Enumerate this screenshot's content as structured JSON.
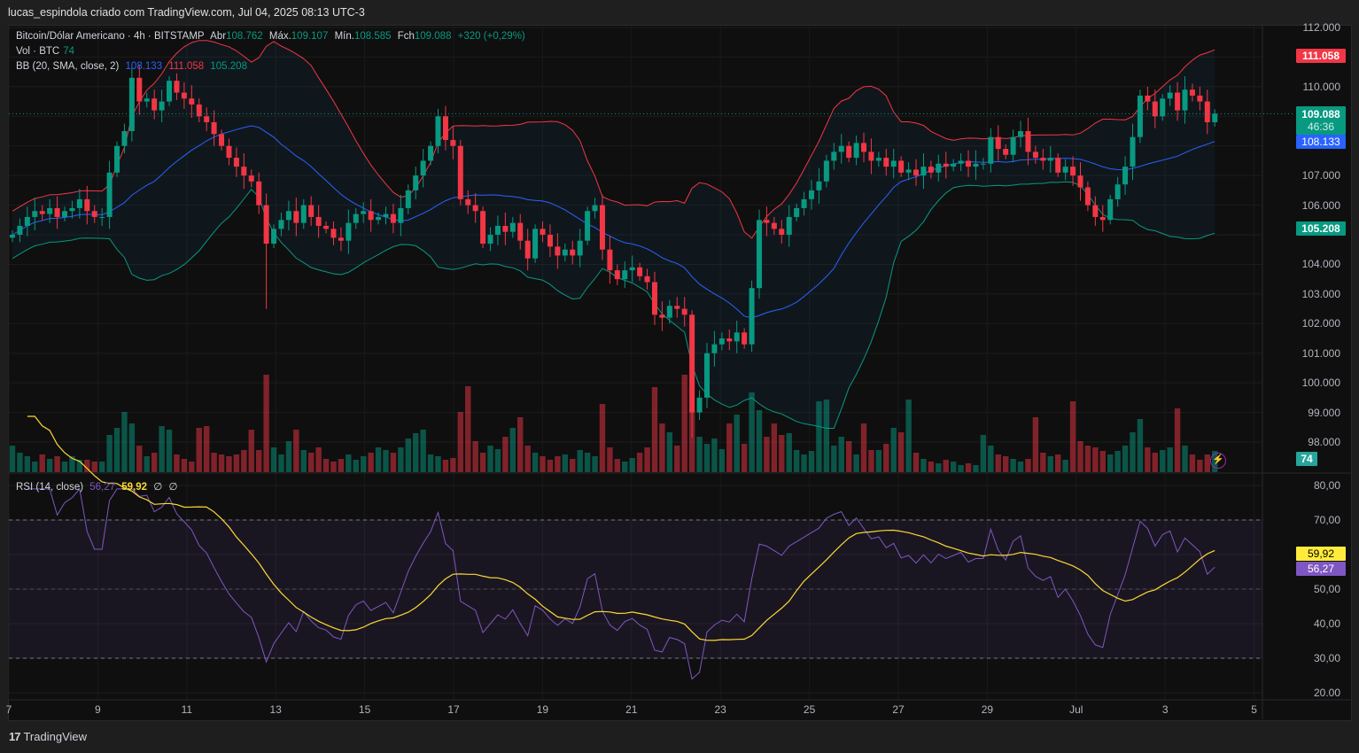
{
  "topbar": {
    "title": "lucas_espindola criado com TradingView.com, Jul 04, 2025 08:13 UTC-3"
  },
  "legend": {
    "symbol": "Bitcoin/Dólar Americano · 4h · BITSTAMP",
    "open_label": "Abr",
    "open": "108.762",
    "high_label": "Máx.",
    "high": "109.107",
    "low_label": "Mín.",
    "low": "108.585",
    "close_label": "Fch",
    "close": "109.088",
    "change": "+320 (+0,29%)",
    "vol_label": "Vol · BTC",
    "vol": "74",
    "bb_label": "BB (20, SMA, close, 2)",
    "bb_basis": "108.133",
    "bb_upper": "111.058",
    "bb_lower": "105.208",
    "rsi_label": "RSI (14, close)",
    "rsi": "56,27",
    "rsi_ma": "59,92",
    "rsi_x1": "∅",
    "rsi_x2": "∅"
  },
  "price_axis": [
    "112.000",
    "110.000",
    "107.000",
    "106.000",
    "104.000",
    "103.000",
    "102.000",
    "101.000",
    "100.000",
    "99.000",
    "98.000"
  ],
  "price_tags": {
    "upper": "111.058",
    "last": "109.088",
    "countdown": "46:36",
    "basis": "108.133",
    "lower": "105.208",
    "volume": "74"
  },
  "rsi_axis": [
    "80,00",
    "70,00",
    "50,00",
    "40,00",
    "30,00",
    "20.00"
  ],
  "rsi_tags": {
    "ma": "59,92",
    "rsi": "56,27"
  },
  "date_axis": [
    "7",
    "9",
    "11",
    "13",
    "15",
    "17",
    "19",
    "21",
    "23",
    "25",
    "27",
    "29",
    "Jul",
    "3",
    "5"
  ],
  "footer": {
    "brand": "TradingView"
  },
  "colors": {
    "up": "#089981",
    "down": "#f23645",
    "basis": "#2962ff",
    "rsi": "#7e57c2",
    "rsi_ma": "#fdd835"
  },
  "chart_data": {
    "type": "candlestick",
    "timeframe": "4h",
    "ylim": [
      97500,
      112000
    ],
    "closes": [
      105.0,
      105.3,
      105.6,
      105.8,
      105.7,
      105.9,
      105.6,
      105.8,
      105.9,
      106.2,
      105.8,
      105.6,
      105.6,
      107.1,
      108.0,
      108.5,
      110.3,
      109.5,
      109.6,
      109.2,
      109.5,
      110.2,
      109.8,
      109.6,
      109.4,
      109.0,
      108.8,
      108.4,
      108.0,
      107.6,
      107.3,
      107.0,
      106.8,
      106.0,
      104.7,
      105.2,
      105.5,
      105.8,
      105.4,
      106.0,
      105.6,
      105.3,
      105.2,
      104.9,
      104.8,
      105.4,
      105.7,
      105.8,
      105.5,
      105.6,
      105.7,
      105.4,
      105.9,
      106.5,
      107.0,
      107.5,
      108.0,
      109.0,
      108.2,
      108.0,
      106.2,
      106.0,
      105.8,
      104.7,
      105.0,
      105.3,
      105.1,
      105.4,
      104.8,
      104.2,
      105.2,
      105.0,
      104.6,
      104.3,
      104.5,
      104.3,
      104.8,
      105.8,
      106.0,
      104.5,
      103.8,
      103.5,
      103.8,
      103.9,
      103.6,
      103.4,
      102.3,
      102.2,
      102.6,
      102.5,
      102.3,
      99.0,
      99.5,
      101.0,
      101.3,
      101.5,
      101.4,
      101.7,
      101.3,
      103.2,
      105.5,
      105.4,
      105.2,
      105.0,
      105.6,
      105.9,
      106.2,
      106.5,
      106.8,
      107.5,
      107.8,
      108.0,
      107.6,
      108.1,
      107.8,
      107.5,
      107.6,
      107.3,
      107.5,
      107.1,
      107.2,
      107.0,
      107.3,
      107.1,
      107.4,
      107.3,
      107.4,
      107.5,
      107.3,
      107.4,
      107.4,
      108.3,
      107.9,
      107.7,
      108.3,
      108.5,
      107.8,
      107.6,
      107.5,
      107.6,
      107.1,
      107.3,
      107.0,
      106.6,
      106.0,
      105.6,
      105.5,
      106.2,
      106.7,
      107.3,
      108.3,
      109.7,
      109.5,
      109.0,
      109.6,
      109.8,
      109.2,
      109.9,
      109.7,
      109.5,
      108.8,
      109.088
    ],
    "volumes": [
      30,
      22,
      18,
      12,
      20,
      15,
      18,
      12,
      18,
      14,
      14,
      12,
      12,
      42,
      50,
      68,
      55,
      30,
      18,
      22,
      52,
      48,
      20,
      15,
      12,
      50,
      52,
      22,
      20,
      18,
      20,
      25,
      48,
      25,
      110,
      28,
      20,
      35,
      48,
      25,
      22,
      28,
      15,
      12,
      15,
      20,
      14,
      18,
      22,
      28,
      25,
      22,
      28,
      38,
      44,
      48,
      20,
      18,
      14,
      16,
      68,
      97,
      35,
      22,
      30,
      26,
      40,
      50,
      62,
      30,
      22,
      18,
      14,
      18,
      20,
      15,
      25,
      22,
      18,
      77,
      28,
      15,
      12,
      16,
      22,
      28,
      96,
      55,
      45,
      30,
      110,
      70,
      40,
      32,
      38,
      26,
      55,
      65,
      32,
      90,
      70,
      40,
      55,
      42,
      44,
      25,
      20,
      24,
      80,
      82,
      30,
      40,
      35,
      20,
      55,
      25,
      25,
      32,
      50,
      45,
      82,
      22,
      15,
      12,
      10,
      14,
      12,
      8,
      10,
      8,
      42,
      30,
      20,
      18,
      15,
      12,
      15,
      62,
      22,
      18,
      20,
      14,
      80,
      35,
      30,
      28,
      24,
      20,
      24,
      30,
      45,
      60,
      28,
      22,
      25,
      28,
      72,
      30,
      20,
      14,
      20,
      24
    ]
  }
}
